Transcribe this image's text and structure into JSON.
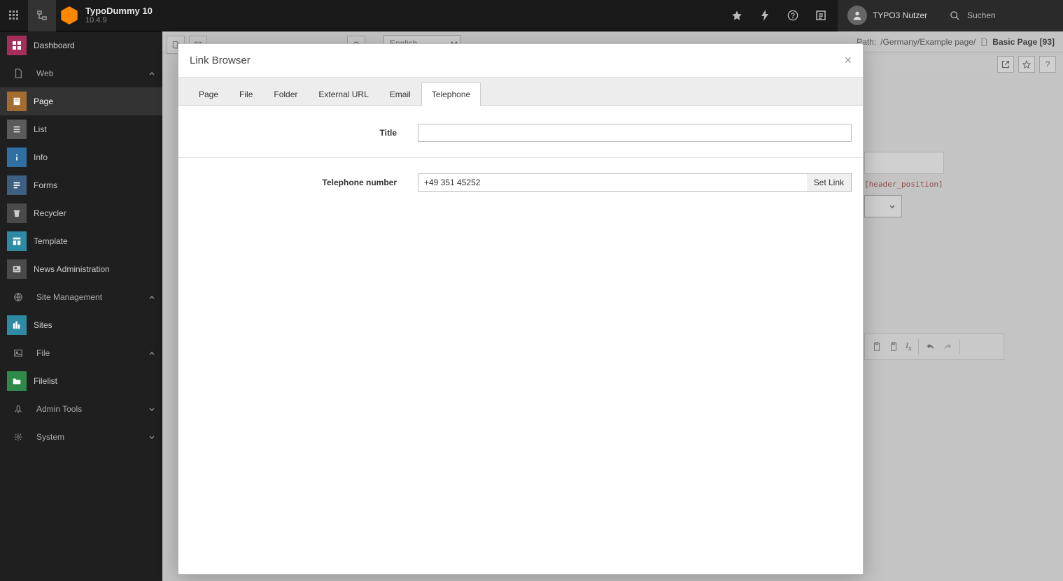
{
  "topbar": {
    "app_name": "TypoDummy 10",
    "version": "10.4.9",
    "username": "TYPO3 Nutzer",
    "search_placeholder": "Suchen"
  },
  "sidebar": {
    "dashboard": "Dashboard",
    "groups": {
      "web": {
        "label": "Web",
        "items": {
          "page": "Page",
          "list": "List",
          "info": "Info",
          "forms": "Forms",
          "recycler": "Recycler",
          "template": "Template",
          "news": "News Administration"
        }
      },
      "site": {
        "label": "Site Management",
        "items": {
          "sites": "Sites"
        }
      },
      "file": {
        "label": "File",
        "items": {
          "filelist": "Filelist"
        }
      },
      "admin": {
        "label": "Admin Tools"
      },
      "system": {
        "label": "System"
      }
    }
  },
  "docheader": {
    "lang": "English",
    "path_prefix": "Path:",
    "path": "/Germany/Example page/",
    "record_title": "Basic Page [93]"
  },
  "bg": {
    "header_position_label": "[header_position]"
  },
  "modal": {
    "title": "Link Browser",
    "tabs": {
      "page": "Page",
      "file": "File",
      "folder": "Folder",
      "external": "External URL",
      "email": "Email",
      "telephone": "Telephone"
    },
    "fields": {
      "title_label": "Title",
      "title_value": "",
      "phone_label": "Telephone number",
      "phone_value": "+49 351 45252",
      "set_link": "Set Link"
    }
  }
}
